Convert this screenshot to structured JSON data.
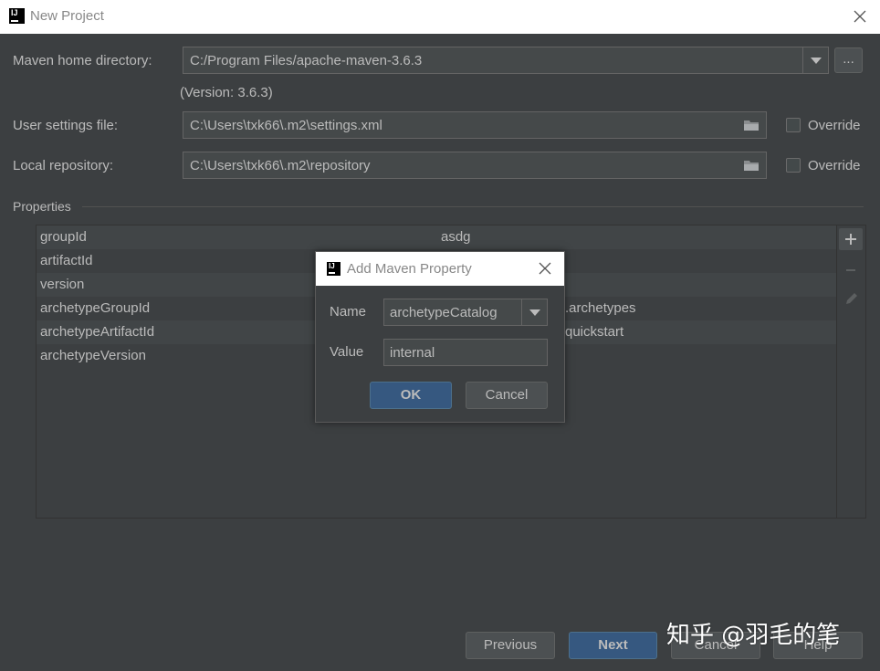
{
  "window": {
    "title": "New Project"
  },
  "form": {
    "maven_home_label": "Maven home directory:",
    "maven_home_value": "C:/Program Files/apache-maven-3.6.3",
    "maven_home_browse": "...",
    "version_note": "(Version: 3.6.3)",
    "user_settings_label": "User settings file:",
    "user_settings_value": "C:\\Users\\txk66\\.m2\\settings.xml",
    "user_settings_override": "Override",
    "local_repo_label": "Local repository:",
    "local_repo_value": "C:\\Users\\txk66\\.m2\\repository",
    "local_repo_override": "Override"
  },
  "properties": {
    "section_label": "Properties",
    "rows": [
      {
        "key": "groupId",
        "value": "asdg"
      },
      {
        "key": "artifactId",
        "value": ""
      },
      {
        "key": "version",
        "value": ""
      },
      {
        "key": "archetypeGroupId",
        "value": ""
      },
      {
        "key": "archetypeArtifactId",
        "value": ""
      },
      {
        "key": "archetypeVersion",
        "value": ""
      }
    ],
    "visible_fragments": {
      "row4_suffix": ".archetypes",
      "row5_suffix": "quickstart"
    }
  },
  "dialog": {
    "title": "Add Maven Property",
    "name_label": "Name",
    "name_value": "archetypeCatalog",
    "value_label": "Value",
    "value_value": "internal",
    "ok_label": "OK",
    "cancel_label": "Cancel"
  },
  "footer": {
    "previous_label": "Previous",
    "next_label": "Next",
    "cancel_label": "Cancel",
    "help_label": "Help"
  },
  "watermark": {
    "text": "知乎 @羽毛的笔"
  }
}
